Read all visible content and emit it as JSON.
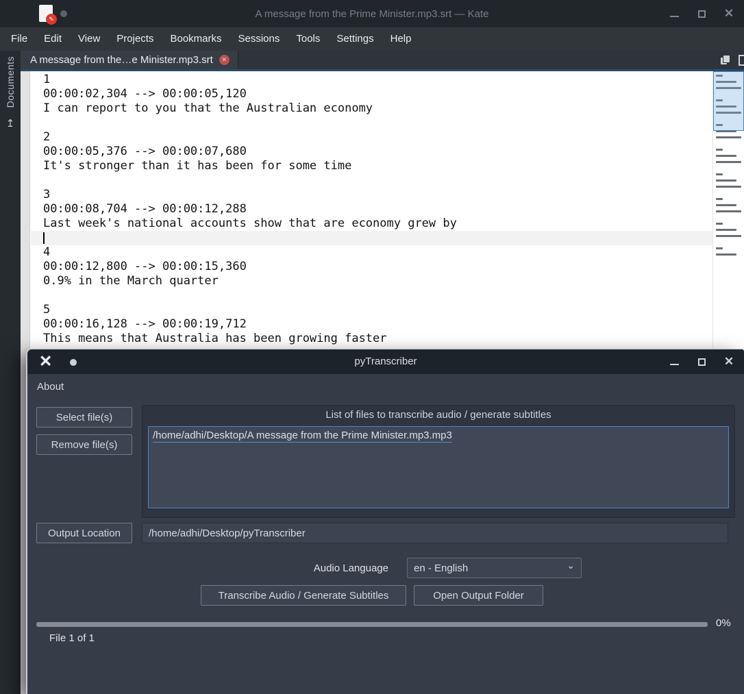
{
  "kate": {
    "title": "A message from the Prime Minister.mp3.srt — Kate",
    "menu_items": [
      "File",
      "Edit",
      "View",
      "Projects",
      "Bookmarks",
      "Sessions",
      "Tools",
      "Settings",
      "Help"
    ],
    "tab_label": "A message from the…e Minister.mp3.srt",
    "documents_panel_label": "Documents",
    "editor_lines": [
      "1",
      "00:00:02,304 --> 00:00:05,120",
      "I can report to you that the Australian economy",
      "",
      "2",
      "00:00:05,376 --> 00:00:07,680",
      "It's stronger than it has been for some time",
      "",
      "3",
      "00:00:08,704 --> 00:00:12,288",
      "Last week's national accounts show that are economy grew by",
      "",
      "4",
      "00:00:12,800 --> 00:00:15,360",
      "0.9% in the March quarter",
      "",
      "5",
      "00:00:16,128 --> 00:00:19,712",
      "This means that Australia has been growing faster"
    ],
    "cursor_line": 11
  },
  "pytranscriber": {
    "title": "pyTranscriber",
    "menu_items": [
      "About"
    ],
    "buttons": {
      "select_files": "Select file(s)",
      "remove_files": "Remove file(s)",
      "output_location": "Output Location",
      "transcribe": "Transcribe Audio / Generate Subtitles",
      "open_output": "Open Output Folder"
    },
    "group_title": "List of files to transcribe audio / generate subtitles",
    "file_list": [
      "/home/adhi/Desktop/A message from the Prime Minister.mp3.mp3"
    ],
    "output_path": "/home/adhi/Desktop/pyTranscriber",
    "audio_language_label": "Audio Language",
    "audio_language_value": "en - English",
    "progress_percent": "0%",
    "progress_value": 0,
    "file_counter": "File 1 of 1"
  },
  "colors": {
    "accent_blue": "#4b87c4",
    "tab_close_red": "#b9524f",
    "kate_icon_red": "#e0382d",
    "editor_bg": "#ffffff",
    "window_bg": "#363d49"
  }
}
